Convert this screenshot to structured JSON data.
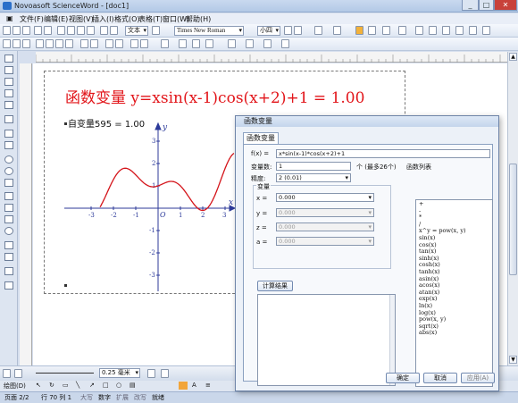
{
  "window": {
    "title": "Novoasoft ScienceWord - [doc1]",
    "min": "_",
    "max": "□",
    "close": "✕"
  },
  "menu": [
    "文件(F)",
    "编辑(E)",
    "视图(V)",
    "插入(I)",
    "格式(O)",
    "表格(T)",
    "窗口(W)",
    "帮助(H)"
  ],
  "toolbar": {
    "style": "文本",
    "font": "Times New Roman",
    "size": "小四"
  },
  "document": {
    "title": "函数变量 y=xsin(x-1)cos(x+2)+1 = 1.00",
    "var_line": "自变量595 = 1.00"
  },
  "graph": {
    "x_ticks": [
      "-3",
      "-2",
      "-1",
      "1",
      "2",
      "3"
    ],
    "y_ticks": [
      "3",
      "2",
      "1",
      "-1",
      "-2",
      "-3"
    ],
    "x_label": "x",
    "y_label": "y",
    "origin": "O"
  },
  "bottom": {
    "line_width": "0.25 毫米"
  },
  "drawbar": {
    "label": "绘图(D)"
  },
  "status": {
    "page": "页面 2/2",
    "pos": "行 70  列 1",
    "ins": "大写",
    "num": "数字",
    "ext": "扩展",
    "rev": "改写",
    "ready": "就绪"
  },
  "dialog": {
    "title": "函数变量",
    "tab": "函数变量",
    "fx_label": "f(x) =",
    "fx_value": "x*sin(x-1)*cos(x+2)+1",
    "varcount_label": "变量数:",
    "varcount_value": "1",
    "varcount_unit": "个 (最多26个)",
    "precision_label": "精度:",
    "precision_value": "2 (0.01)",
    "vars_group_label": "变量",
    "vars": [
      {
        "name": "x =",
        "value": "0.000",
        "enabled": true
      },
      {
        "name": "y =",
        "value": "0.000",
        "enabled": false
      },
      {
        "name": "z =",
        "value": "0.000",
        "enabled": false
      },
      {
        "name": "a =",
        "value": "0.000",
        "enabled": false
      }
    ],
    "calc_button": "计算结果",
    "funclist_label": "函数列表",
    "funcs": [
      "+",
      "-",
      "*",
      "/",
      "x^y = pow(x, y)",
      "sin(x)",
      "cos(x)",
      "tan(x)",
      "sinh(x)",
      "cosh(x)",
      "tanh(x)",
      "asin(x)",
      "acos(x)",
      "atan(x)",
      "exp(x)",
      "ln(x)",
      "log(x)",
      "pow(x, y)",
      "sqrt(x)",
      "abs(x)"
    ],
    "ok": "确定",
    "cancel": "取消",
    "apply": "应用(A)"
  }
}
